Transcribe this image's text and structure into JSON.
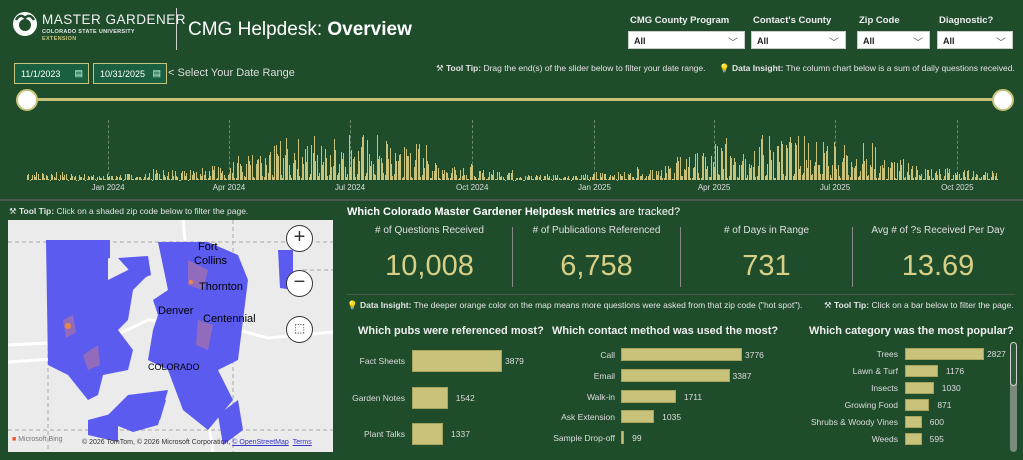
{
  "header": {
    "logo_title": "MASTER GARDENER",
    "logo_sub1": "COLORADO STATE UNIVERSITY",
    "logo_sub2": "EXTENSION",
    "title_prefix": "CMG Helpdesk: ",
    "title_bold": "Overview"
  },
  "filters": [
    {
      "label": "CMG County Program",
      "value": "All"
    },
    {
      "label": "Contact's County",
      "value": "All"
    },
    {
      "label": "Zip Code",
      "value": "All"
    },
    {
      "label": "Diagnostic?",
      "value": "All"
    }
  ],
  "date_range": {
    "start": "11/1/2023",
    "end": "10/31/2025",
    "label": "< Select Your Date Range"
  },
  "tooltips": {
    "slider_tip_bold": "Tool Tip:",
    "slider_tip": " Drag the end(s) of the slider below to filter your date range.",
    "chart_insight_bold": "Data Insight:",
    "chart_insight": " The column chart below is a sum of daily questions received.",
    "map_tip_bold": "Tool Tip:",
    "map_tip": " Click on a shaded zip code below to filter the page.",
    "map_insight_bold": "Data Insight:",
    "map_insight": " The deeper orange color on the map means more questions were asked from that zip code (\"hot spot\").",
    "bar_tip_bold": "Tool Tip:",
    "bar_tip": " Click on a bar below to filter the page."
  },
  "daily_chart": {
    "type": "bar",
    "x_ticks": [
      "Jan 2024",
      "Apr 2024",
      "Jul 2024",
      "Oct 2024",
      "Jan 2025",
      "Apr 2025",
      "Jul 2025",
      "Oct 2025"
    ],
    "monthly_typical_daily": [
      4,
      3,
      3,
      5,
      8,
      12,
      20,
      24,
      22,
      18,
      8,
      5,
      3,
      3,
      4,
      7,
      13,
      20,
      22,
      21,
      18,
      10,
      6,
      5
    ],
    "color": "#c8c27a"
  },
  "map": {
    "labels": [
      "Fort",
      "Collins",
      "Thornton",
      "Denver",
      "Centennial",
      "COLORADO"
    ],
    "attribution": "© 2026 TomTom, © 2026 Microsoft Corporation, ",
    "osm": "© OpenStreetMap",
    "terms": "Terms",
    "bing": "Microsoft Bing",
    "fill_color": "#5b5bf0",
    "hot_color": "#e8894a"
  },
  "metrics": {
    "title_parts": [
      "Which Colorado Master Gardener Helpdesk metrics",
      " are tracked?"
    ],
    "kpis": [
      {
        "label": "# of Questions Received",
        "value": "10,008"
      },
      {
        "label": "# of Publications Referenced",
        "value": "6,758"
      },
      {
        "label": "# of Days in Range",
        "value": "731"
      },
      {
        "label": "Avg # of ?s Received Per Day",
        "value": "13.69"
      }
    ]
  },
  "charts": {
    "pubs": {
      "title": "Which pubs were referenced most?",
      "categories": [
        "Fact Sheets",
        "Garden Notes",
        "Plant Talks"
      ],
      "values": [
        3879,
        1542,
        1337
      ]
    },
    "contact": {
      "title": "Which contact method was used the most?",
      "categories": [
        "Call",
        "Email",
        "Walk-in",
        "Ask Extension",
        "Sample Drop-off"
      ],
      "values": [
        3776,
        3387,
        1711,
        1035,
        99
      ]
    },
    "category": {
      "title": "Which category was the most popular?",
      "categories": [
        "Trees",
        "Lawn & Turf",
        "Insects",
        "Growing Food",
        "Shrubs & Woody Vines",
        "Weeds"
      ],
      "values": [
        2827,
        1176,
        1030,
        871,
        600,
        595
      ]
    }
  }
}
